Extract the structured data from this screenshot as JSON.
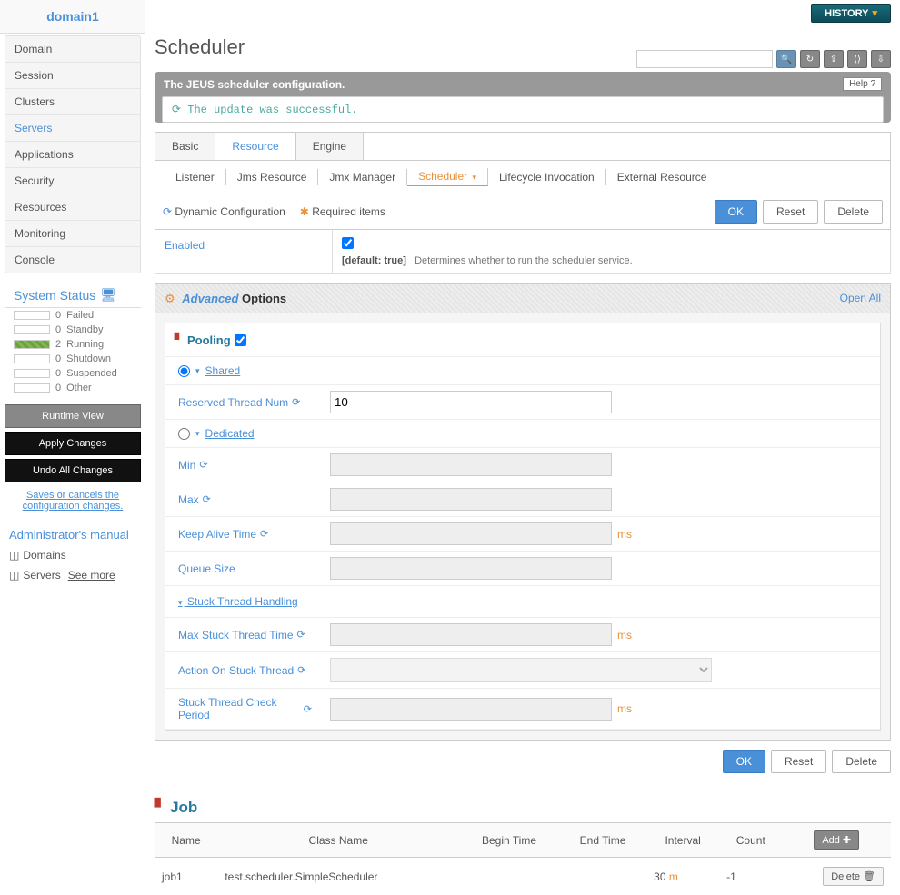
{
  "sidebar": {
    "domain": "domain1",
    "nav": [
      "Domain",
      "Session",
      "Clusters",
      "Servers",
      "Applications",
      "Security",
      "Resources",
      "Monitoring",
      "Console"
    ],
    "activeNav": "Servers",
    "sysStatusTitle": "System Status",
    "statuses": [
      {
        "count": "0",
        "label": "Failed",
        "running": false
      },
      {
        "count": "0",
        "label": "Standby",
        "running": false
      },
      {
        "count": "2",
        "label": "Running",
        "running": true
      },
      {
        "count": "0",
        "label": "Shutdown",
        "running": false
      },
      {
        "count": "0",
        "label": "Suspended",
        "running": false
      },
      {
        "count": "0",
        "label": "Other",
        "running": false
      }
    ],
    "runtimeView": "Runtime View",
    "applyChanges": "Apply Changes",
    "undoChanges": "Undo All Changes",
    "configHint": "Saves or cancels the configuration changes.",
    "adminManualTitle": "Administrator's manual",
    "adminItems": [
      "Domains",
      "Servers"
    ],
    "seeMore": "See more"
  },
  "topbar": {
    "history": "HISTORY"
  },
  "page": {
    "title": "Scheduler",
    "bannerTitle": "The JEUS scheduler configuration.",
    "help": "Help",
    "successMsg": "The update was successful."
  },
  "tabs": {
    "items": [
      "Basic",
      "Resource",
      "Engine"
    ],
    "active": "Resource"
  },
  "subtabs": {
    "items": [
      "Listener",
      "Jms Resource",
      "Jmx Manager",
      "Scheduler",
      "Lifecycle Invocation",
      "External Resource"
    ],
    "active": "Scheduler"
  },
  "actionBar": {
    "dynConfig": "Dynamic Configuration",
    "required": "Required items",
    "ok": "OK",
    "reset": "Reset",
    "delete": "Delete"
  },
  "enabled": {
    "label": "Enabled",
    "default": "[default: true]",
    "desc": "Determines whether to run the scheduler service."
  },
  "advanced": {
    "adv": "Advanced",
    "opts": "Options",
    "openAll": "Open All",
    "pooling": "Pooling",
    "shared": "Shared",
    "dedicated": "Dedicated",
    "reservedThreadNum": "Reserved Thread Num",
    "reservedThreadNumVal": "10",
    "min": "Min",
    "max": "Max",
    "keepAlive": "Keep Alive Time",
    "queueSize": "Queue Size",
    "stuckHandling": "Stuck Thread Handling",
    "maxStuck": "Max Stuck Thread Time",
    "actionStuck": "Action On Stuck Thread",
    "stuckCheck": "Stuck Thread Check Period",
    "ms": "ms"
  },
  "job": {
    "title": "Job",
    "headers": [
      "Name",
      "Class Name",
      "Begin Time",
      "End Time",
      "Interval",
      "Count"
    ],
    "add": "Add",
    "deleteBtn": "Delete",
    "rows": [
      {
        "name": "job1",
        "className": "test.scheduler.SimpleScheduler",
        "beginTime": "",
        "endTime": "",
        "intervalVal": "30",
        "intervalUnit": "m",
        "count": "-1"
      }
    ]
  }
}
